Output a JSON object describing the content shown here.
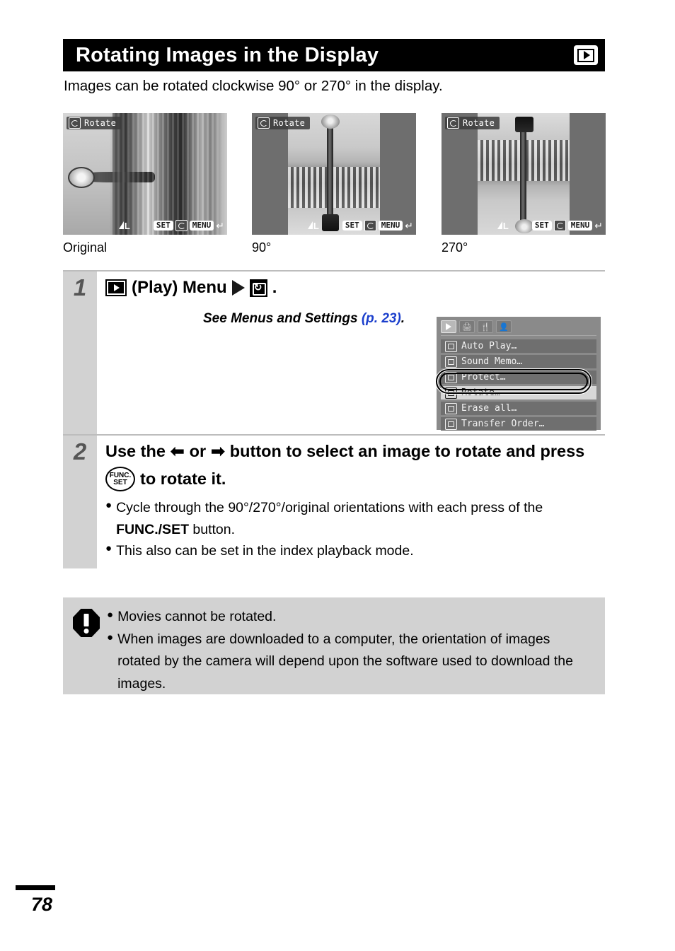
{
  "header": {
    "title": "Rotating Images in the Display",
    "badge_icon": "play-icon"
  },
  "intro": "Images can be rotated clockwise 90° or 270° in the display.",
  "examples": [
    {
      "osd_label": "Rotate",
      "quality": "L",
      "set_key": "SET",
      "menu_key": "MENU",
      "caption": "Original"
    },
    {
      "osd_label": "Rotate",
      "quality": "L",
      "set_key": "SET",
      "menu_key": "MENU",
      "caption": "90°"
    },
    {
      "osd_label": "Rotate",
      "quality": "L",
      "set_key": "SET",
      "menu_key": "MENU",
      "caption": "270°"
    }
  ],
  "steps": [
    {
      "number": "1",
      "headline_play": "(Play) Menu",
      "headline_period": ".",
      "subtext_italic": "See Menus and Settings ",
      "page_ref": "(p. 23)",
      "subtext_end": "."
    },
    {
      "number": "2",
      "headline_part1": "Use the",
      "headline_or": "or",
      "headline_part2": "button to select an image to rotate and press",
      "headline_part3": "to rotate it.",
      "func_set_top": "FUNC.",
      "func_set_bottom": "SET",
      "bullets": [
        "Cycle through the 90°/270°/original orientations with each press of the FUNC./SET button.",
        "This also can be set in the index playback mode."
      ],
      "bullet1_lead": "Cycle through the 90°/270°/original orientations with each press of the ",
      "bullet1_bold": "FUNC./SET",
      "bullet1_tail": " button.",
      "bullet2": "This also can be set in the index playback mode."
    }
  ],
  "camera_menu": {
    "tabs": [
      "play-tab",
      "print-tab",
      "tools-tab",
      "my-camera-tab"
    ],
    "items": [
      "Auto Play…",
      "Sound Memo…",
      "Protect…",
      "Rotate…",
      "Erase all…",
      "Transfer Order…"
    ],
    "selected_item": "Rotate…"
  },
  "warning": {
    "icon": "exclamation-icon",
    "items": [
      "Movies cannot be rotated.",
      "When images are downloaded to a computer, the orientation of images rotated by the camera will depend upon the software used to download the images."
    ]
  },
  "footer": {
    "page_number": "78"
  },
  "colors": {
    "header_bg": "#000000",
    "header_text": "#ffffff",
    "step_num_bg": "#d2d2d2",
    "warning_bg": "#d2d2d2",
    "page_ref_link": "#1b3fcc"
  }
}
